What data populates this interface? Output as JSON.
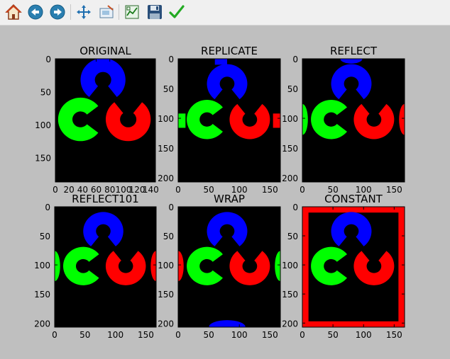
{
  "toolbar": {
    "buttons": [
      {
        "id": "home",
        "icon": "home-icon"
      },
      {
        "id": "back",
        "icon": "back-arrow-icon"
      },
      {
        "id": "forward",
        "icon": "forward-arrow-icon"
      },
      {
        "id": "pan",
        "icon": "pan-move-icon"
      },
      {
        "id": "zoom",
        "icon": "zoom-rect-icon"
      },
      {
        "id": "subplots",
        "icon": "configure-subplots-icon"
      },
      {
        "id": "save",
        "icon": "save-floppy-icon"
      },
      {
        "id": "edit",
        "icon": "edit-check-icon"
      }
    ]
  },
  "colors": {
    "figure_bg": "#bfbfbf",
    "blue": "#0000ff",
    "green": "#00ff00",
    "red": "#ff0000",
    "black": "#000000"
  },
  "chart_data": [
    {
      "type": "image",
      "title": "ORIGINAL",
      "xlim": [
        0,
        147
      ],
      "ylim": [
        0,
        187
      ],
      "xticks": [
        0,
        20,
        40,
        60,
        80,
        100,
        120,
        140
      ],
      "yticks": [
        0,
        50,
        100,
        150
      ]
    },
    {
      "type": "image",
      "title": "REPLICATE",
      "xlim": [
        0,
        167
      ],
      "ylim": [
        0,
        207
      ],
      "xticks": [
        0,
        50,
        100,
        150
      ],
      "yticks": [
        0,
        50,
        100,
        150,
        200
      ]
    },
    {
      "type": "image",
      "title": "REFLECT",
      "xlim": [
        0,
        167
      ],
      "ylim": [
        0,
        207
      ],
      "xticks": [
        0,
        50,
        100,
        150
      ],
      "yticks": [
        0,
        50,
        100,
        150,
        200
      ]
    },
    {
      "type": "image",
      "title": "REFLECT101",
      "xlim": [
        0,
        167
      ],
      "ylim": [
        0,
        207
      ],
      "xticks": [
        0,
        50,
        100,
        150
      ],
      "yticks": [
        0,
        50,
        100,
        150,
        200
      ]
    },
    {
      "type": "image",
      "title": "WRAP",
      "xlim": [
        0,
        167
      ],
      "ylim": [
        0,
        207
      ],
      "xticks": [
        0,
        50,
        100,
        150
      ],
      "yticks": [
        0,
        50,
        100,
        150,
        200
      ]
    },
    {
      "type": "image",
      "title": "CONSTANT",
      "xlim": [
        0,
        167
      ],
      "ylim": [
        0,
        207
      ],
      "xticks": [
        0,
        50,
        100,
        150
      ],
      "yticks": [
        0,
        50,
        100,
        150,
        200
      ],
      "border_color": "#ff0000",
      "border_width": 10
    }
  ]
}
